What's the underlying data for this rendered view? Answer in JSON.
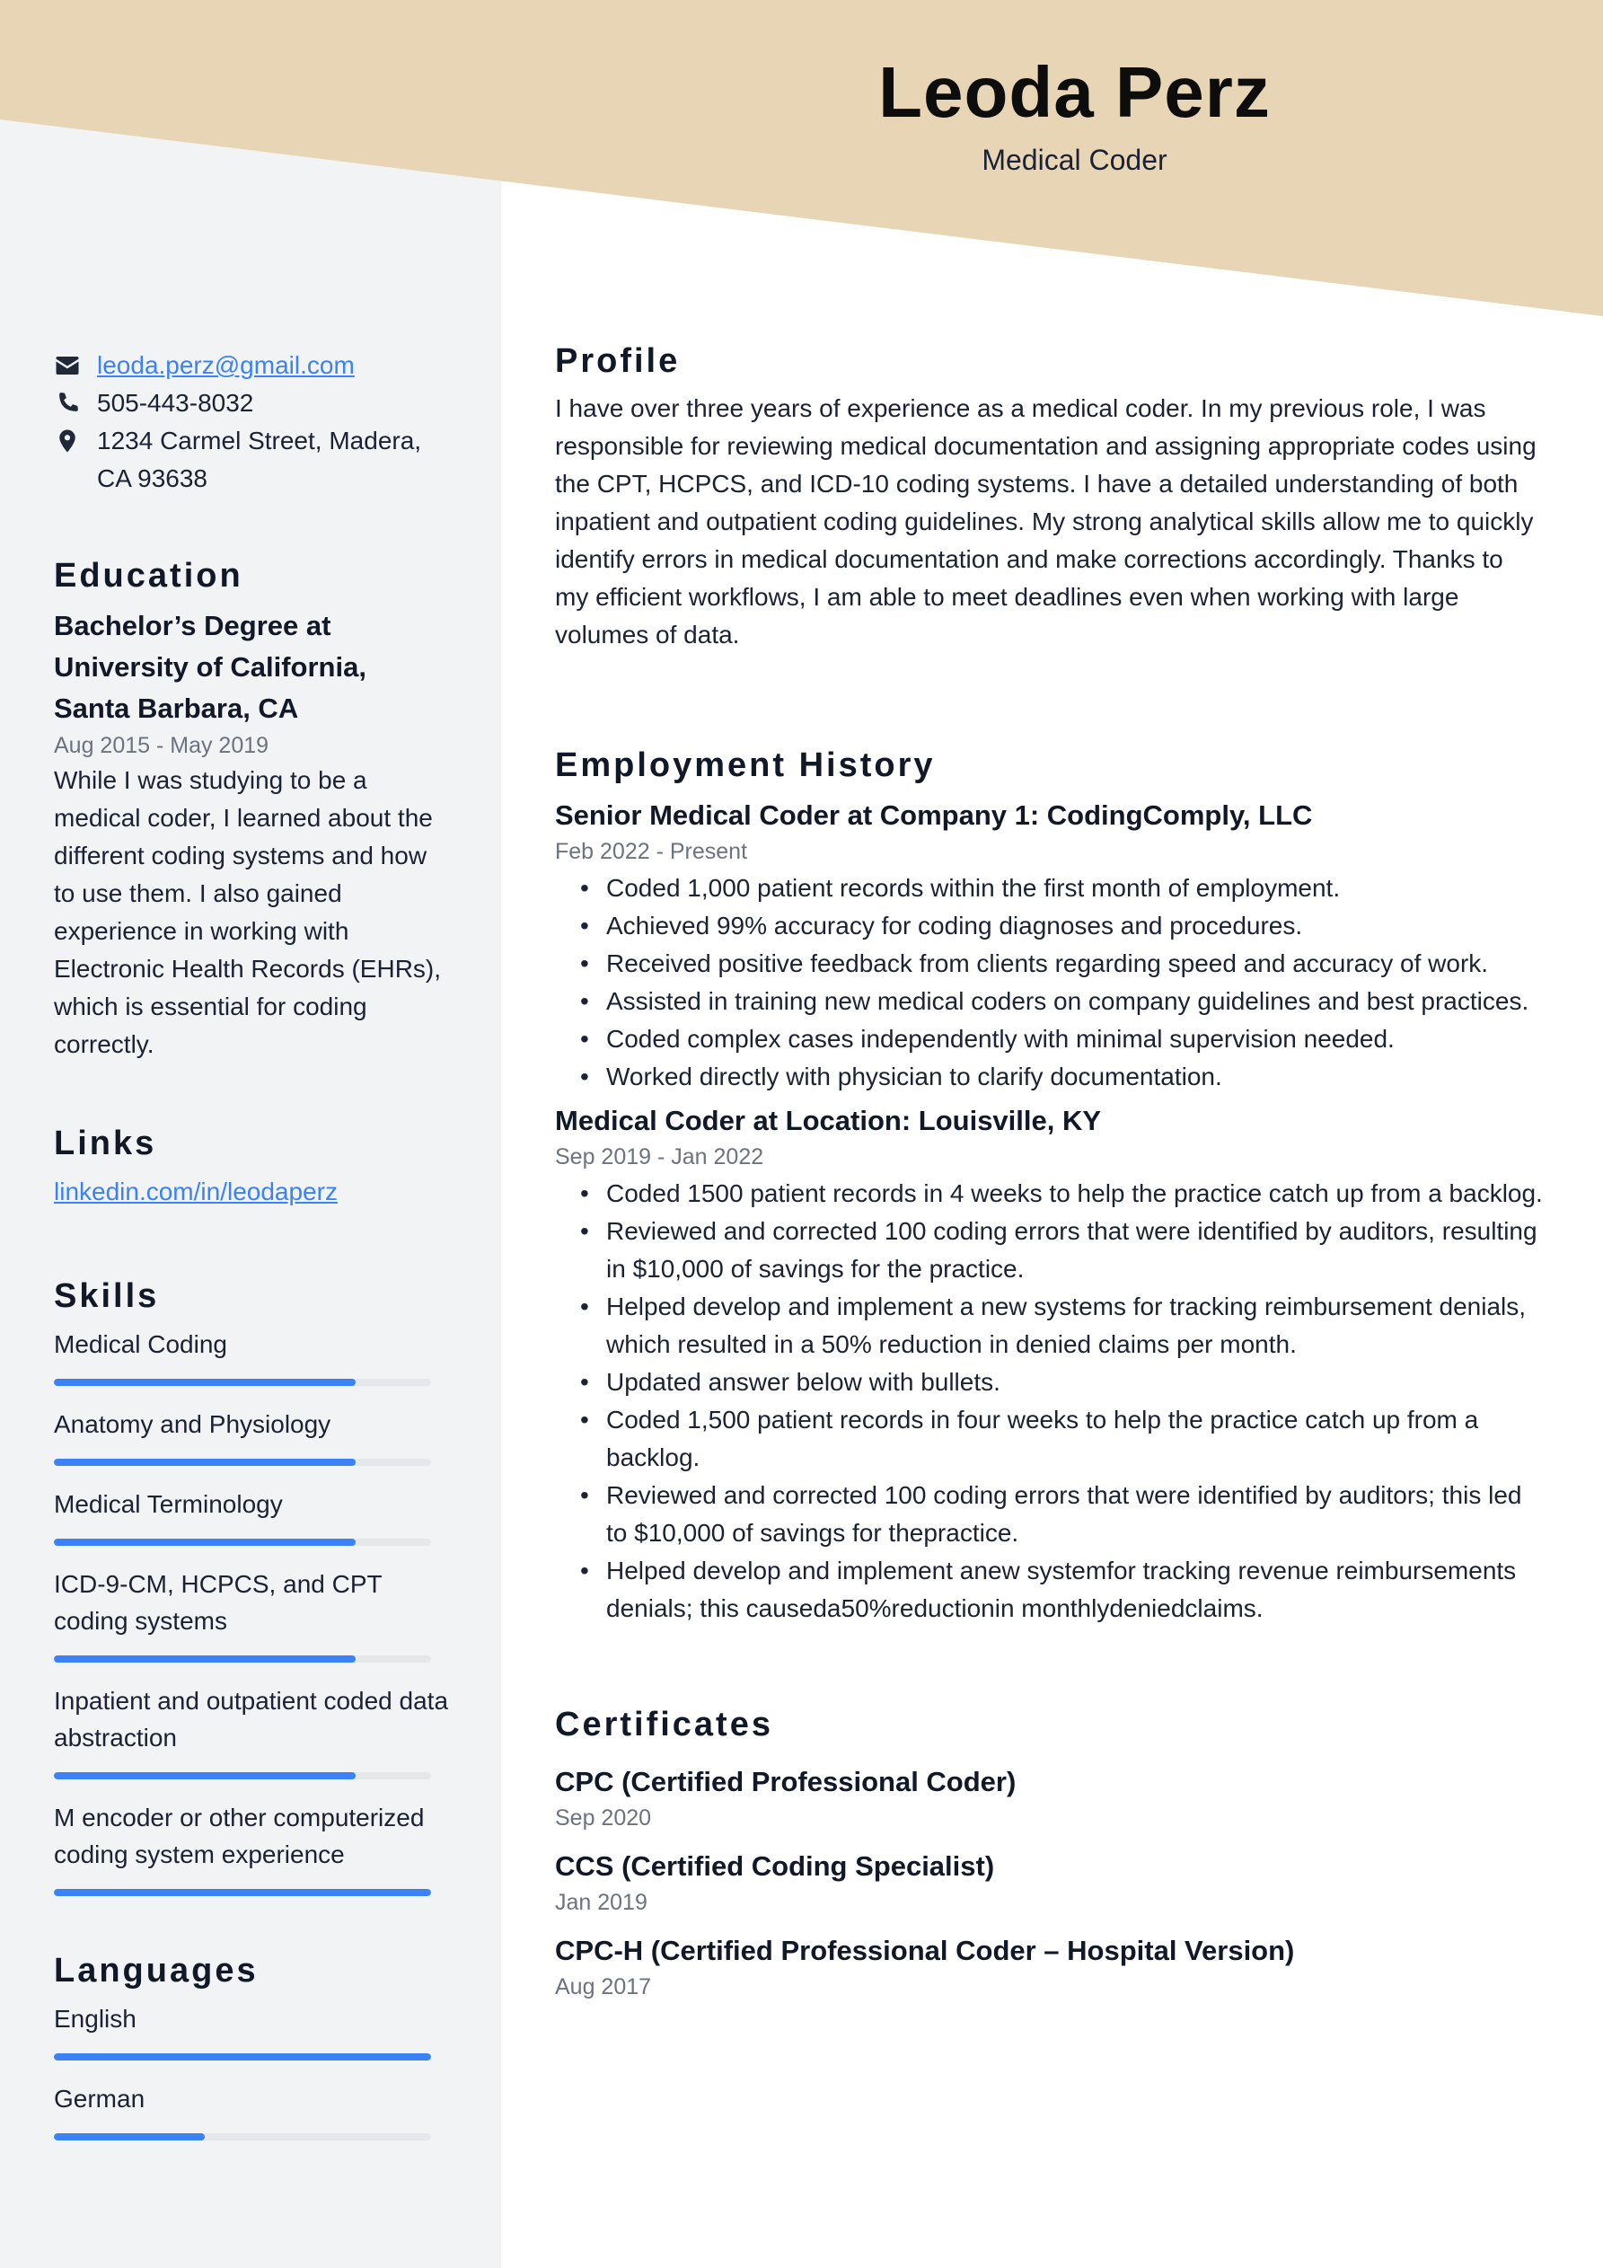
{
  "header": {
    "name": "Leoda Perz",
    "job_title": "Medical Coder",
    "accent_color": "#e8d5b5"
  },
  "contact": {
    "email": "leoda.perz@gmail.com",
    "phone": "505-443-8032",
    "address_line1": "1234 Carmel Street, Madera,",
    "address_line2": "CA 93638",
    "icons": [
      "envelope-icon",
      "phone-icon",
      "map-pin-icon"
    ]
  },
  "education": {
    "heading": "Education",
    "title_lines": [
      "Bachelor’s Degree at",
      "University of California,",
      "Santa Barbara, CA"
    ],
    "dates": "Aug 2015 - May 2019",
    "description": "While I was studying to be a medical coder, I learned about the different coding systems and how to use them. I also gained experience in working with Electronic Health Records (EHRs), which is essential for coding correctly."
  },
  "links": {
    "heading": "Links",
    "items": [
      "linkedin.com/in/leodaperz"
    ]
  },
  "skills": {
    "heading": "Skills",
    "bar_color": "#3b82f6",
    "items": [
      {
        "label": "Medical Coding",
        "level_percent": 80
      },
      {
        "label": "Anatomy and Physiology",
        "level_percent": 80
      },
      {
        "label": "Medical Terminology",
        "level_percent": 80
      },
      {
        "label": "ICD-9-CM, HCPCS, and CPT coding systems",
        "level_percent": 80
      },
      {
        "label": "Inpatient and outpatient coded data abstraction",
        "level_percent": 80
      },
      {
        "label": "M encoder or other computerized coding system experience",
        "level_percent": 100
      }
    ]
  },
  "languages": {
    "heading": "Languages",
    "items": [
      {
        "label": "English",
        "level_percent": 100
      },
      {
        "label": "German",
        "level_percent": 40
      }
    ]
  },
  "profile": {
    "heading": "Profile",
    "text": "I have over three years of experience as a medical coder. In my previous role, I was responsible for reviewing medical documentation and assigning appropriate codes using the CPT, HCPCS, and ICD-10 coding systems. I have a detailed understanding of both inpatient and outpatient coding guidelines. My strong analytical skills allow me to quickly identify errors in medical documentation and make corrections accordingly. Thanks to my efficient workflows, I am able to meet deadlines even when working with large volumes of data."
  },
  "employment": {
    "heading": "Employment History",
    "jobs": [
      {
        "title": "Senior Medical Coder at Company 1: CodingComply, LLC",
        "dates": "Feb 2022 - Present",
        "bullets": [
          "Coded 1,000 patient records within the first month of employment.",
          "Achieved 99% accuracy for coding diagnoses and procedures.",
          "Received positive feedback from clients regarding speed and accuracy of work.",
          "Assisted in training new medical coders on company guidelines and best practices.",
          "Coded complex cases independently with minimal supervision needed.",
          "Worked directly with physician to clarify documentation."
        ]
      },
      {
        "title": "Medical Coder at Location: Louisville, KY",
        "dates": "Sep 2019 - Jan 2022",
        "bullets": [
          "Coded 1500 patient records in 4 weeks to help the practice catch up from a backlog.",
          "Reviewed and corrected 100 coding errors that were identified by auditors, resulting in $10,000 of savings for the practice.",
          "Helped develop and implement a new systems for tracking reimbursement denials, which resulted in a 50% reduction in denied claims per month.",
          "Updated answer below with bullets.",
          "Coded 1,500 patient records in four weeks to help the practice catch up from a backlog.",
          "Reviewed and corrected 100 coding errors that were identified by auditors; this led to $10,000 of savings for thepractice.",
          "Helped develop and implement anew systemfor tracking revenue reimbursements denials; this causeda50%reductionin monthlydeniedclaims."
        ]
      }
    ]
  },
  "certificates": {
    "heading": "Certificates",
    "items": [
      {
        "title": "CPC (Certified Professional Coder)",
        "date": "Sep 2020"
      },
      {
        "title": "CCS (Certified Coding Specialist)",
        "date": "Jan 2019"
      },
      {
        "title": "CPC-H (Certified Professional Coder – Hospital Version)",
        "date": "Aug 2017"
      }
    ]
  }
}
